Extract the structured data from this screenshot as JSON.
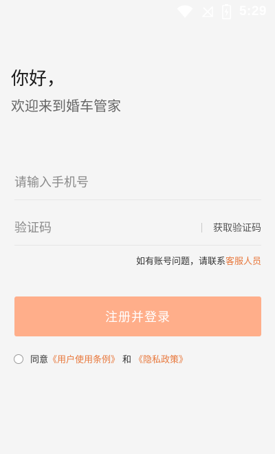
{
  "status_bar": {
    "time": "5:29",
    "icons": [
      "wifi-icon",
      "no-signal-icon",
      "battery-charging-icon"
    ]
  },
  "greeting": {
    "title": "你好，",
    "subtitle": "欢迎来到婚车管家"
  },
  "form": {
    "phone_placeholder": "请输入手机号",
    "code_placeholder": "验证码",
    "get_code_label": "获取验证码"
  },
  "help": {
    "text": "如有账号问题，请联系",
    "link": "客服人员"
  },
  "register_button": {
    "label": "注册并登录"
  },
  "agreement": {
    "prefix": "同意",
    "terms_link": "《用户使用条例》",
    "and": "和",
    "privacy_link": "《隐私政策》"
  },
  "colors": {
    "accent": "#e8783c",
    "button": "#ffae8a",
    "background": "#f5f5f5"
  }
}
